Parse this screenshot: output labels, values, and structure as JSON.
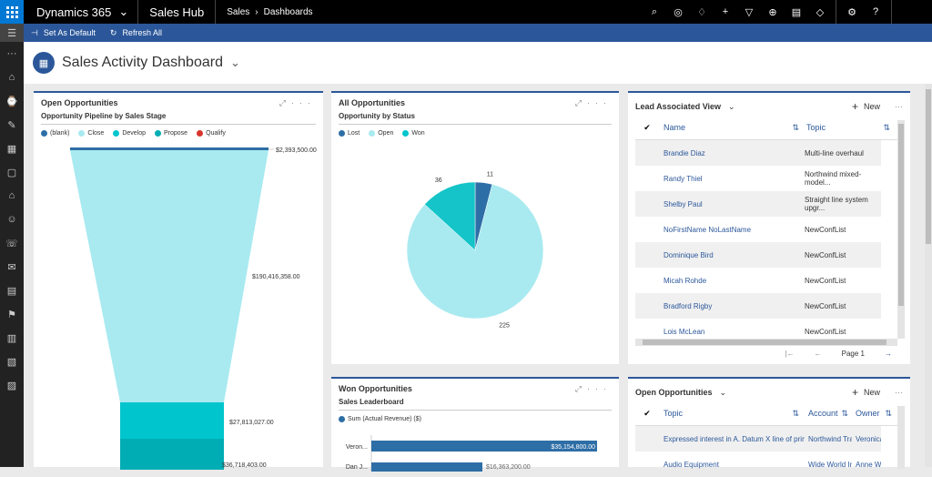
{
  "topbar": {
    "product": "Dynamics 365",
    "app": "Sales Hub",
    "breadcrumb_area": "Sales",
    "breadcrumb_page": "Dashboards"
  },
  "commands": {
    "set_default": "Set As Default",
    "refresh_all": "Refresh All"
  },
  "page": {
    "title": "Sales Activity Dashboard"
  },
  "open_opps": {
    "title": "Open Opportunities",
    "subtitle": "Opportunity Pipeline by Sales Stage",
    "legend": [
      {
        "label": "(blank)",
        "color": "#2e6ea6"
      },
      {
        "label": "Close",
        "color": "#a8eaf0"
      },
      {
        "label": "Develop",
        "color": "#00c5cd"
      },
      {
        "label": "Propose",
        "color": "#00adb5"
      },
      {
        "label": "Qualify",
        "color": "#d8342c"
      }
    ],
    "labels": {
      "l1": "$2,393,500.00",
      "l2": "$190,416,358.00",
      "l3": "$27,813,027.00",
      "l4": "$36,718,403.00"
    }
  },
  "all_opps": {
    "title": "All Opportunities",
    "subtitle": "Opportunity by Status",
    "legend": [
      {
        "label": "Lost",
        "color": "#2e6ea6"
      },
      {
        "label": "Open",
        "color": "#a8eaf0"
      },
      {
        "label": "Won",
        "color": "#00c5cd"
      }
    ]
  },
  "chart_data": {
    "type": "pie",
    "title": "Opportunity by Status",
    "categories": [
      "Lost",
      "Open",
      "Won"
    ],
    "values": [
      11,
      225,
      36
    ],
    "colors": [
      "#2e6ea6",
      "#a8eaf0",
      "#14c4c8"
    ]
  },
  "won_opps": {
    "title": "Won Opportunities",
    "subtitle": "Sales Leaderboard",
    "legend": "Sum (Actual Revenue) ($)",
    "bars": [
      {
        "label": "Veron...",
        "value_label": "$35,154,800.00"
      },
      {
        "label": "Dan J...",
        "value_label": "$16,363,200.00"
      }
    ]
  },
  "lead_view": {
    "title": "Lead Associated View",
    "new_label": "New",
    "col_name": "Name",
    "col_topic": "Topic",
    "rows": [
      {
        "name": "Brandie Diaz",
        "topic": "Multi-line overhaul"
      },
      {
        "name": "Randy Thiel",
        "topic": "Northwind mixed-model..."
      },
      {
        "name": "Shelby Paul",
        "topic": "Straight line system upgr..."
      },
      {
        "name": "NoFirstName NoLastName",
        "topic": "NewConfList"
      },
      {
        "name": "Dominique Bird",
        "topic": "NewConfList"
      },
      {
        "name": "Micah Rohde",
        "topic": "NewConfList"
      },
      {
        "name": "Bradford Rigby",
        "topic": "NewConfList"
      },
      {
        "name": "Lois McLean",
        "topic": "NewConfList"
      }
    ],
    "page_label": "Page 1"
  },
  "open_opps_view": {
    "title": "Open Opportunities",
    "new_label": "New",
    "col_topic": "Topic",
    "col_account": "Account",
    "col_owner": "Owner",
    "rows": [
      {
        "topic": "Expressed interest in A. Datum X line of printers",
        "account": "Northwind Tra",
        "owner": "Veronica Q"
      },
      {
        "topic": "Audio Equipment",
        "account": "Wide World In",
        "owner": "Anne Weile"
      }
    ]
  },
  "colors": {
    "accent": "#2b579a",
    "topbar": "#000000"
  }
}
